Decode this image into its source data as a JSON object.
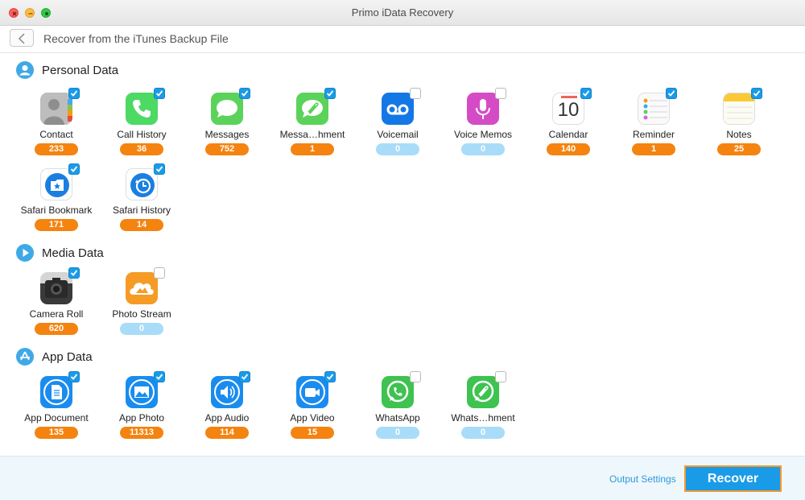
{
  "window": {
    "title": "Primo iData Recovery"
  },
  "header": {
    "title": "Recover from the iTunes Backup File"
  },
  "sections": {
    "personal": {
      "title": "Personal Data",
      "items": [
        {
          "label": "Contact",
          "count": "233",
          "checked": true
        },
        {
          "label": "Call History",
          "count": "36",
          "checked": true
        },
        {
          "label": "Messages",
          "count": "752",
          "checked": true
        },
        {
          "label": "Messa…hment",
          "count": "1",
          "checked": true
        },
        {
          "label": "Voicemail",
          "count": "0",
          "checked": false
        },
        {
          "label": "Voice Memos",
          "count": "0",
          "checked": false
        },
        {
          "label": "Calendar",
          "count": "140",
          "checked": true
        },
        {
          "label": "Reminder",
          "count": "1",
          "checked": true
        },
        {
          "label": "Notes",
          "count": "25",
          "checked": true
        },
        {
          "label": "Safari Bookmark",
          "count": "171",
          "checked": true
        },
        {
          "label": "Safari History",
          "count": "14",
          "checked": true
        }
      ]
    },
    "media": {
      "title": "Media Data",
      "items": [
        {
          "label": "Camera Roll",
          "count": "620",
          "checked": true
        },
        {
          "label": "Photo Stream",
          "count": "0",
          "checked": false
        }
      ]
    },
    "app": {
      "title": "App Data",
      "items": [
        {
          "label": "App Document",
          "count": "135",
          "checked": true
        },
        {
          "label": "App Photo",
          "count": "11313",
          "checked": true
        },
        {
          "label": "App Audio",
          "count": "114",
          "checked": true
        },
        {
          "label": "App Video",
          "count": "15",
          "checked": true
        },
        {
          "label": "WhatsApp",
          "count": "0",
          "checked": false
        },
        {
          "label": "Whats…hment",
          "count": "0",
          "checked": false
        }
      ]
    }
  },
  "calendar_day": "10",
  "footer": {
    "output_settings": "Output Settings",
    "recover_label": "Recover"
  },
  "colors": {
    "accent": "#1a9be8",
    "badge_active": "#f5830f",
    "badge_empty": "#a8dcf8",
    "recover_border": "#f59a2d"
  }
}
